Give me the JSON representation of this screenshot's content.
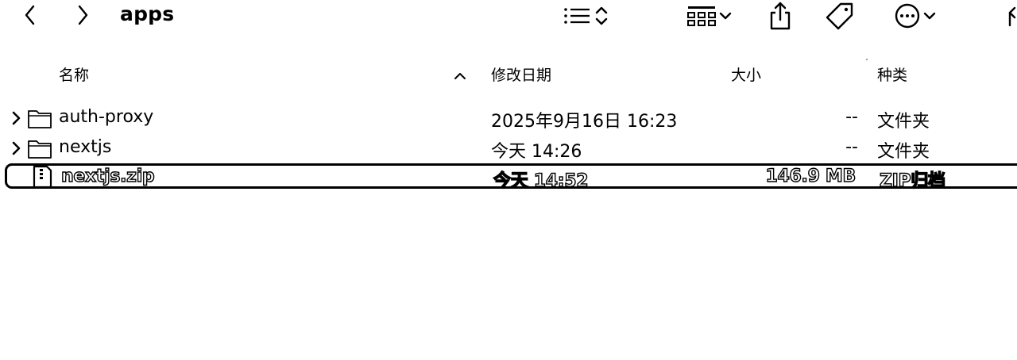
{
  "toolbar": {
    "title": "apps",
    "icons": [
      "chevron-left-icon",
      "chevron-right-icon",
      "list-view-icon",
      "up-down-chevron-icon",
      "grid-group-icon",
      "chevron-down-icon",
      "share-icon",
      "tag-icon",
      "ellipsis-circle-icon"
    ]
  },
  "header": {
    "name": "名称",
    "date": "修改日期",
    "size": "大小",
    "kind": "种类",
    "sort_direction": "ascending"
  },
  "files": [
    {
      "name": "auth-proxy",
      "date": "2025年9月16日 16:23",
      "size": "--",
      "kind": "文件夹",
      "type": "folder",
      "selected": false
    },
    {
      "name": "nextjs",
      "date": "今天 14:26",
      "size": "--",
      "kind": "文件夹",
      "type": "folder",
      "selected": false
    },
    {
      "name": "nextjs.zip",
      "date": "今天 14:52",
      "size": "146.9 MB",
      "kind": "ZIP归档",
      "type": "zip",
      "selected": true
    }
  ]
}
